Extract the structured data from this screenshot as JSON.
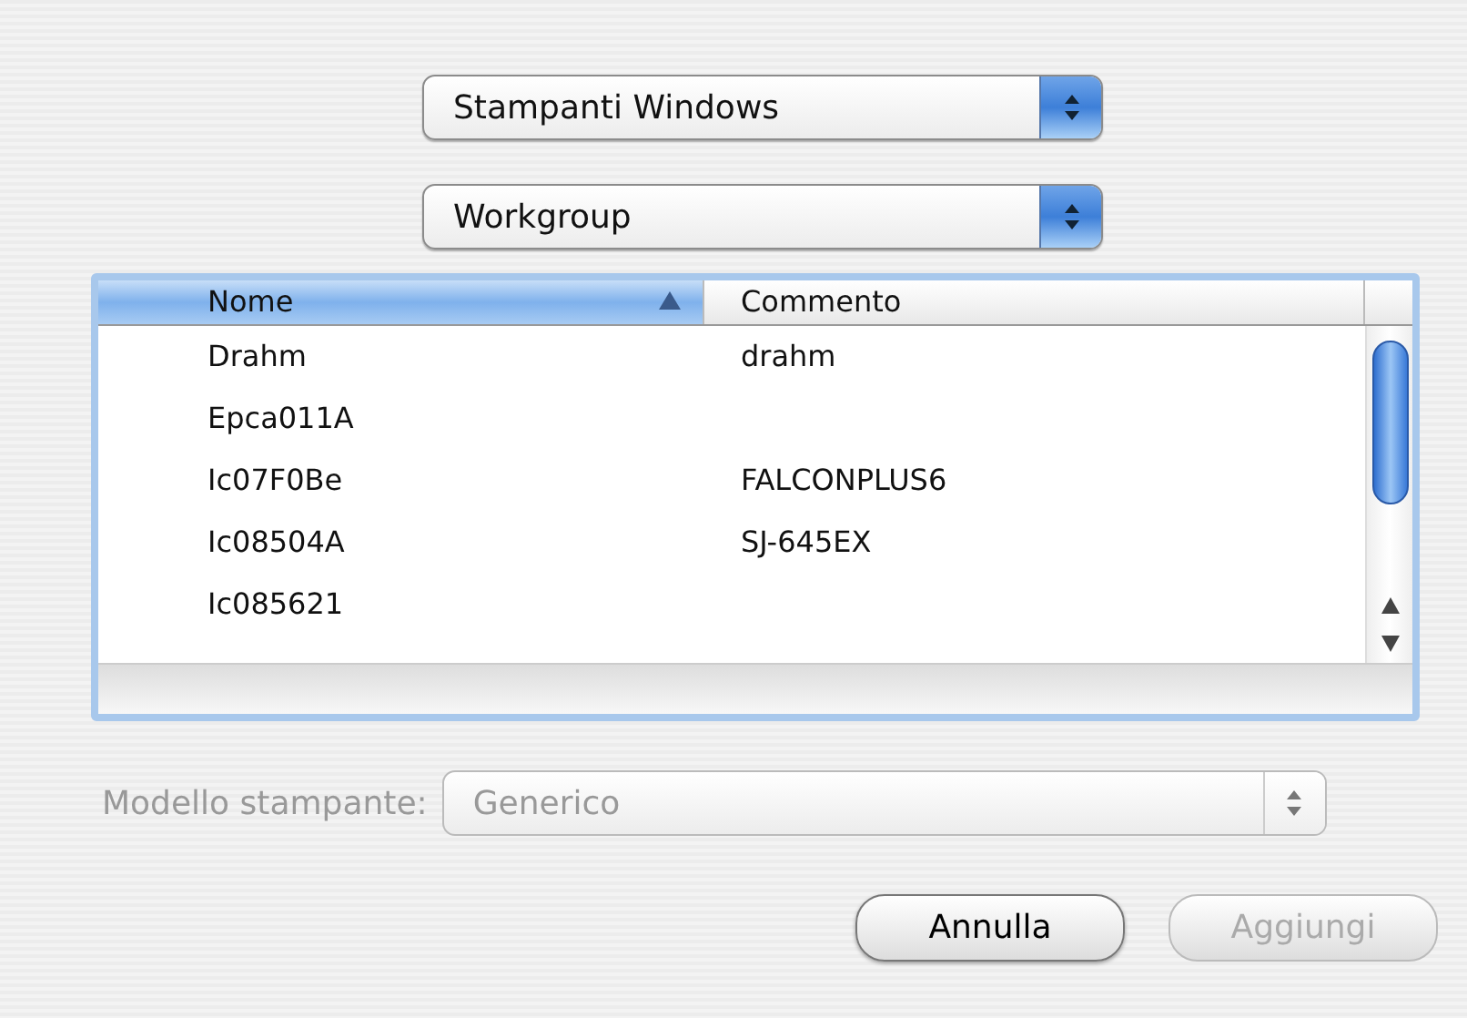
{
  "popups": [
    {
      "value": "Stampanti Windows",
      "disabled": false
    },
    {
      "value": "Workgroup",
      "disabled": false
    }
  ],
  "table": {
    "columns": [
      {
        "label": "Nome",
        "selected": true
      },
      {
        "label": "Commento",
        "selected": false
      }
    ],
    "rows": [
      {
        "cells": [
          "Drahm",
          "drahm"
        ]
      },
      {
        "cells": [
          "Epca011A",
          ""
        ]
      },
      {
        "cells": [
          "Ic07F0Be",
          "FALCONPLUS6"
        ]
      },
      {
        "cells": [
          "Ic08504A",
          "SJ-645EX"
        ]
      },
      {
        "cells": [
          "Ic085621",
          ""
        ]
      }
    ]
  },
  "model": {
    "label": "Modello stampante:",
    "value": "Generico",
    "disabled": true
  },
  "buttons": [
    {
      "label": "Annulla",
      "disabled": false
    },
    {
      "label": "Aggiungi",
      "disabled": true
    }
  ]
}
